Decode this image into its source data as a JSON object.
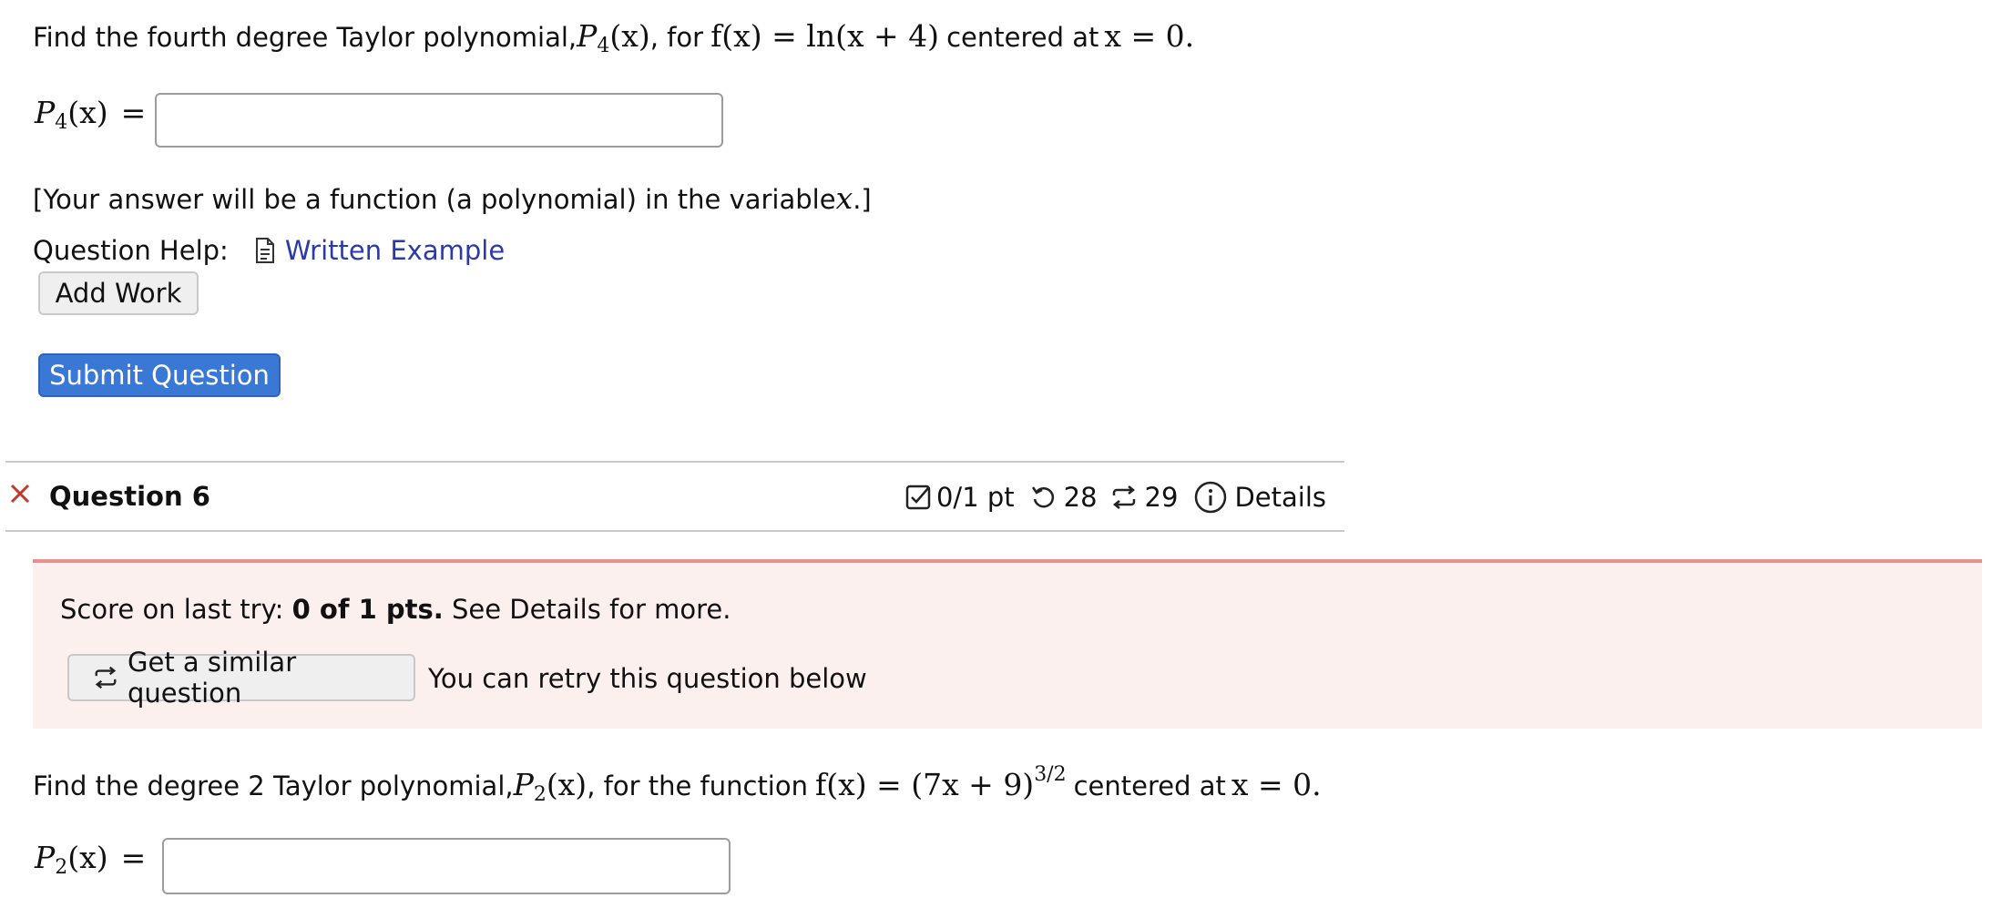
{
  "q5": {
    "prompt_pre": "Find the fourth degree Taylor polynomial, ",
    "prompt_mid1": ", for ",
    "prompt_mid2": " centered at ",
    "poly_symbol": "P",
    "poly_sub": "4",
    "poly_arg": "(x)",
    "func": "f(x) = ln(x + 4)",
    "center": "x = 0.",
    "answer_label_eq": "=",
    "answer_value": "",
    "hint_pre": "[Your answer will be a function (a polynomial) in the variable ",
    "hint_var": "x",
    "hint_post": ".]",
    "help_label": "Question Help:",
    "help_link": "Written Example",
    "add_work": "Add Work",
    "submit": "Submit Question"
  },
  "q6": {
    "title": "Question 6",
    "status_icon": "x-mark-icon",
    "score": "0/1 pt",
    "retries": "28",
    "similar_count": "29",
    "details": "Details",
    "alert": {
      "score_pre": "Score on last try: ",
      "score_bold": "0 of 1 pts.",
      "score_post": " See Details for more.",
      "similar_button": "Get a similar question",
      "retry_note": "You can retry this question below"
    },
    "prompt_pre": "Find the degree 2 Taylor polynomial, ",
    "prompt_mid1": ", for the function ",
    "prompt_mid2": " centered at ",
    "poly_symbol": "P",
    "poly_sub": "2",
    "poly_arg": "(x)",
    "func_base": "f(x) = (7x + 9)",
    "func_exp": "3/2",
    "center": "x = 0.",
    "answer_label_eq": "=",
    "answer_value": ""
  },
  "colors": {
    "link": "#2b3aa8",
    "primary_button": "#3a78d6",
    "alert_bg": "#fcf0ef",
    "alert_border": "#e8908c",
    "error_x": "#c0392b"
  }
}
